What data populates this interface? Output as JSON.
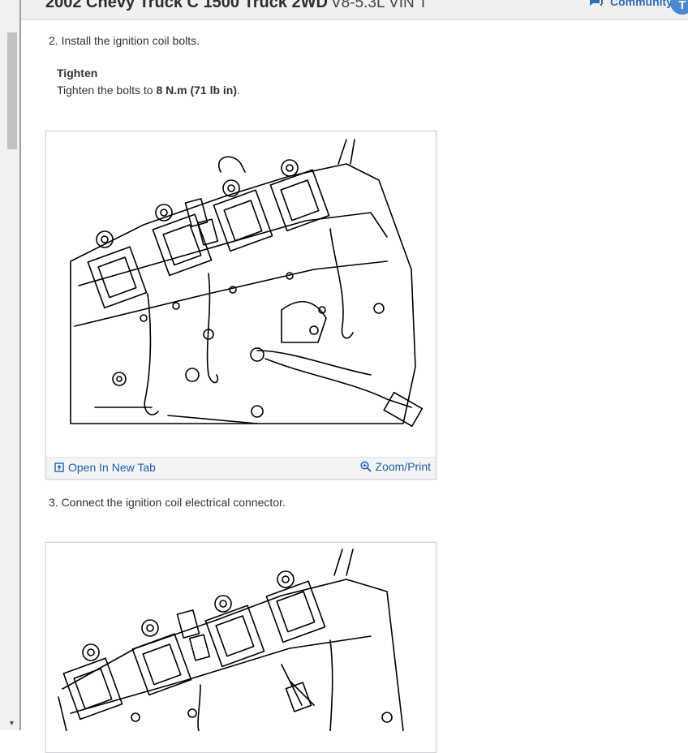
{
  "header": {
    "vehicle_title": "2002 Chevy Truck C 1500 Truck 2WD",
    "engine": "V8-5.3L VIN T",
    "community_label": "Community",
    "badge_text": "T"
  },
  "steps": {
    "step2": "2. Install the ignition coil bolts.",
    "tighten_heading": "Tighten",
    "tighten_prefix": "Tighten the bolts to ",
    "torque": "8 N.m (71 lb in)",
    "tighten_suffix": ".",
    "step3": "3. Connect the ignition coil electrical connector."
  },
  "figure": {
    "open_tab_label": "Open In New Tab",
    "zoom_label": "Zoom/Print"
  },
  "icons": {
    "community": "chat-bubble-icon",
    "open_tab": "open-new-tab-icon",
    "zoom": "zoom-magnifier-icon"
  },
  "colors": {
    "link": "#1f5fa8",
    "community": "#2f6db5",
    "badge": "#4b88d2"
  }
}
